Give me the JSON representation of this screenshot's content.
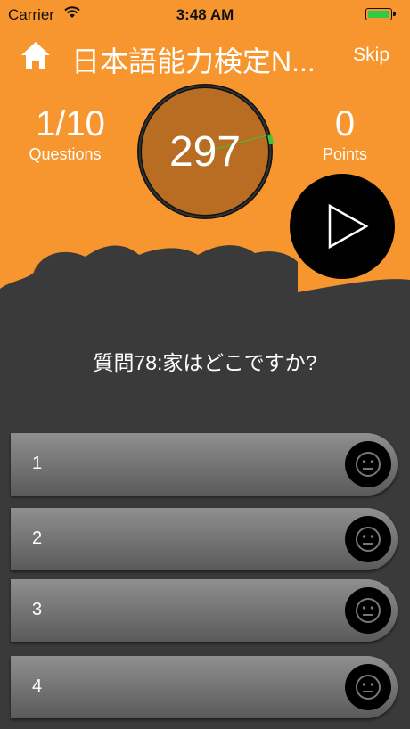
{
  "status_bar": {
    "carrier": "Carrier",
    "time": "3:48 AM",
    "battery_color": "#2ecc40"
  },
  "header": {
    "home_icon": "home-icon",
    "title": "日本語能力検定N...",
    "skip_label": "Skip"
  },
  "stats": {
    "questions_value": "1/10",
    "questions_label": "Questions",
    "points_value": "0",
    "points_label": "Points"
  },
  "timer": {
    "value": "297",
    "accent": "#3fc43a"
  },
  "play_icon": "play-icon",
  "question": {
    "text": "質問78:家はどこですか?"
  },
  "answers": [
    {
      "label": "1",
      "icon": "neutral-face-icon"
    },
    {
      "label": "2",
      "icon": "neutral-face-icon"
    },
    {
      "label": "3",
      "icon": "neutral-face-icon"
    },
    {
      "label": "4",
      "icon": "neutral-face-icon"
    }
  ],
  "colors": {
    "top_background": "#f7962e",
    "bottom_background": "#3a3a3a"
  }
}
